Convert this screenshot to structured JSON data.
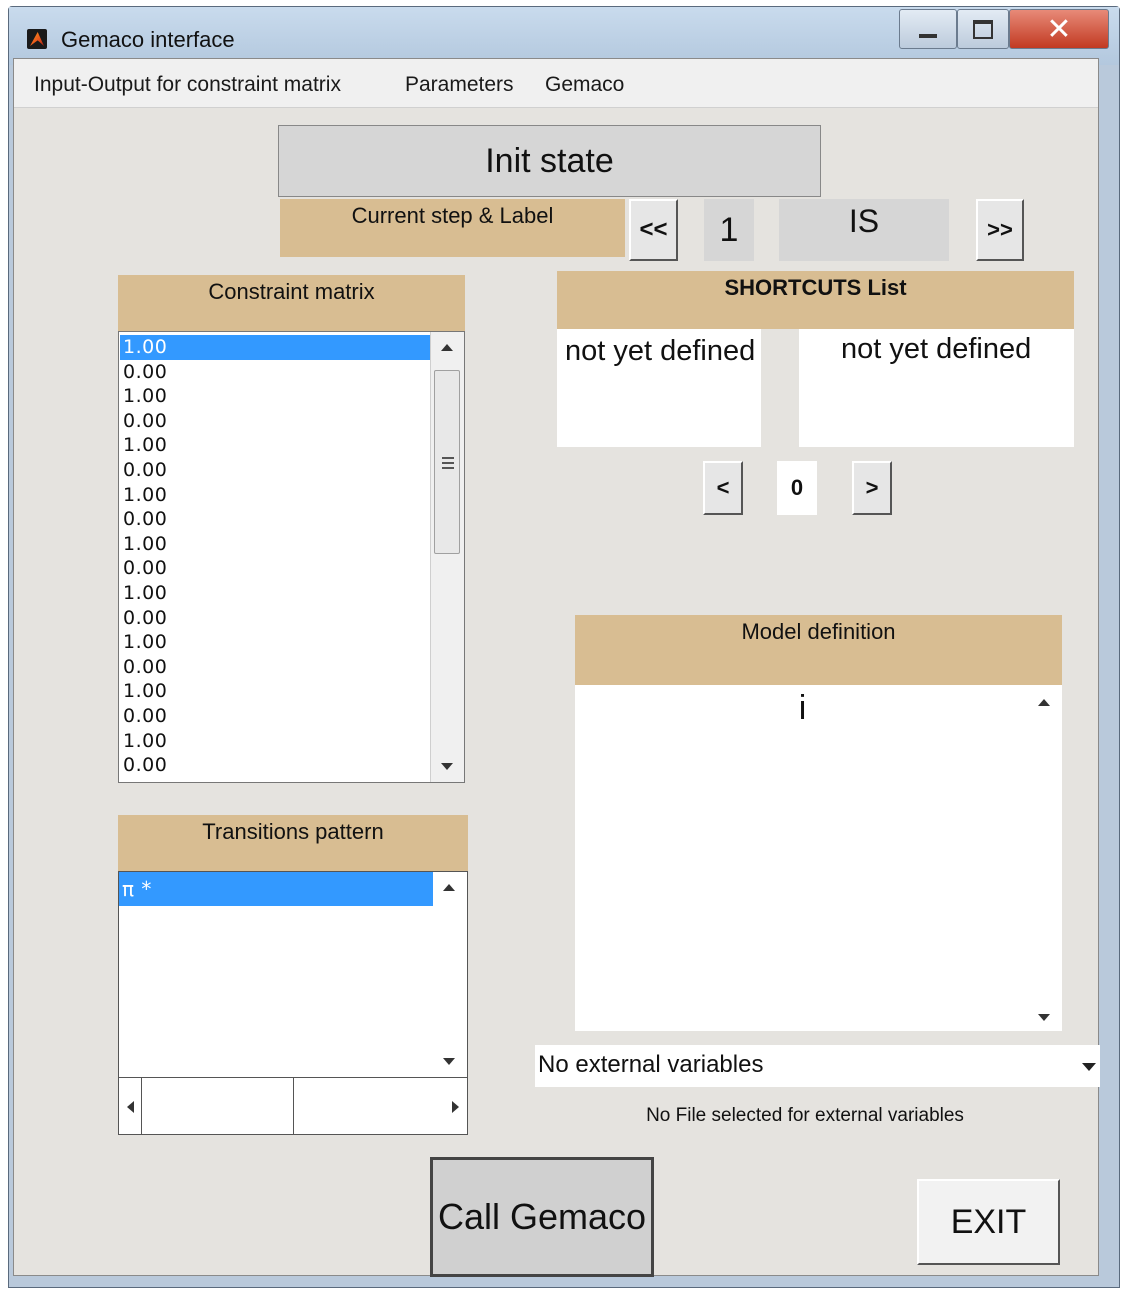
{
  "window": {
    "title": "Gemaco interface"
  },
  "menubar": {
    "items": [
      "Input-Output for constraint matrix",
      "Parameters",
      "Gemaco"
    ]
  },
  "init_state": {
    "label": "Init state"
  },
  "step": {
    "label": "Current step & Label",
    "prev_label": "<<",
    "number": "1",
    "state_label": "IS",
    "next_label": ">>"
  },
  "constraint_matrix": {
    "title": "Constraint matrix",
    "rows": [
      "1.00",
      "0.00",
      "1.00",
      "0.00",
      "1.00",
      "0.00",
      "1.00",
      "0.00",
      "1.00",
      "0.00",
      "1.00",
      "0.00",
      "1.00",
      "0.00",
      "1.00",
      "0.00",
      "1.00",
      "0.00"
    ],
    "selected_index": 0
  },
  "shortcuts": {
    "title": "SHORTCUTS List",
    "left_text": "not yet defined",
    "right_text": "not yet defined",
    "prev_label": "<",
    "index": "0",
    "next_label": ">"
  },
  "model_definition": {
    "title": "Model definition",
    "content": "i"
  },
  "transitions": {
    "title": "Transitions pattern",
    "rows": [
      "π *"
    ]
  },
  "external": {
    "dropdown_value": "No external variables",
    "status": "No File selected for external variables"
  },
  "actions": {
    "call_label": "Call Gemaco",
    "exit_label": "EXIT"
  },
  "colors": {
    "label_background": "#d8bd92",
    "selection": "#3399ff",
    "panel": "#e5e3df"
  }
}
